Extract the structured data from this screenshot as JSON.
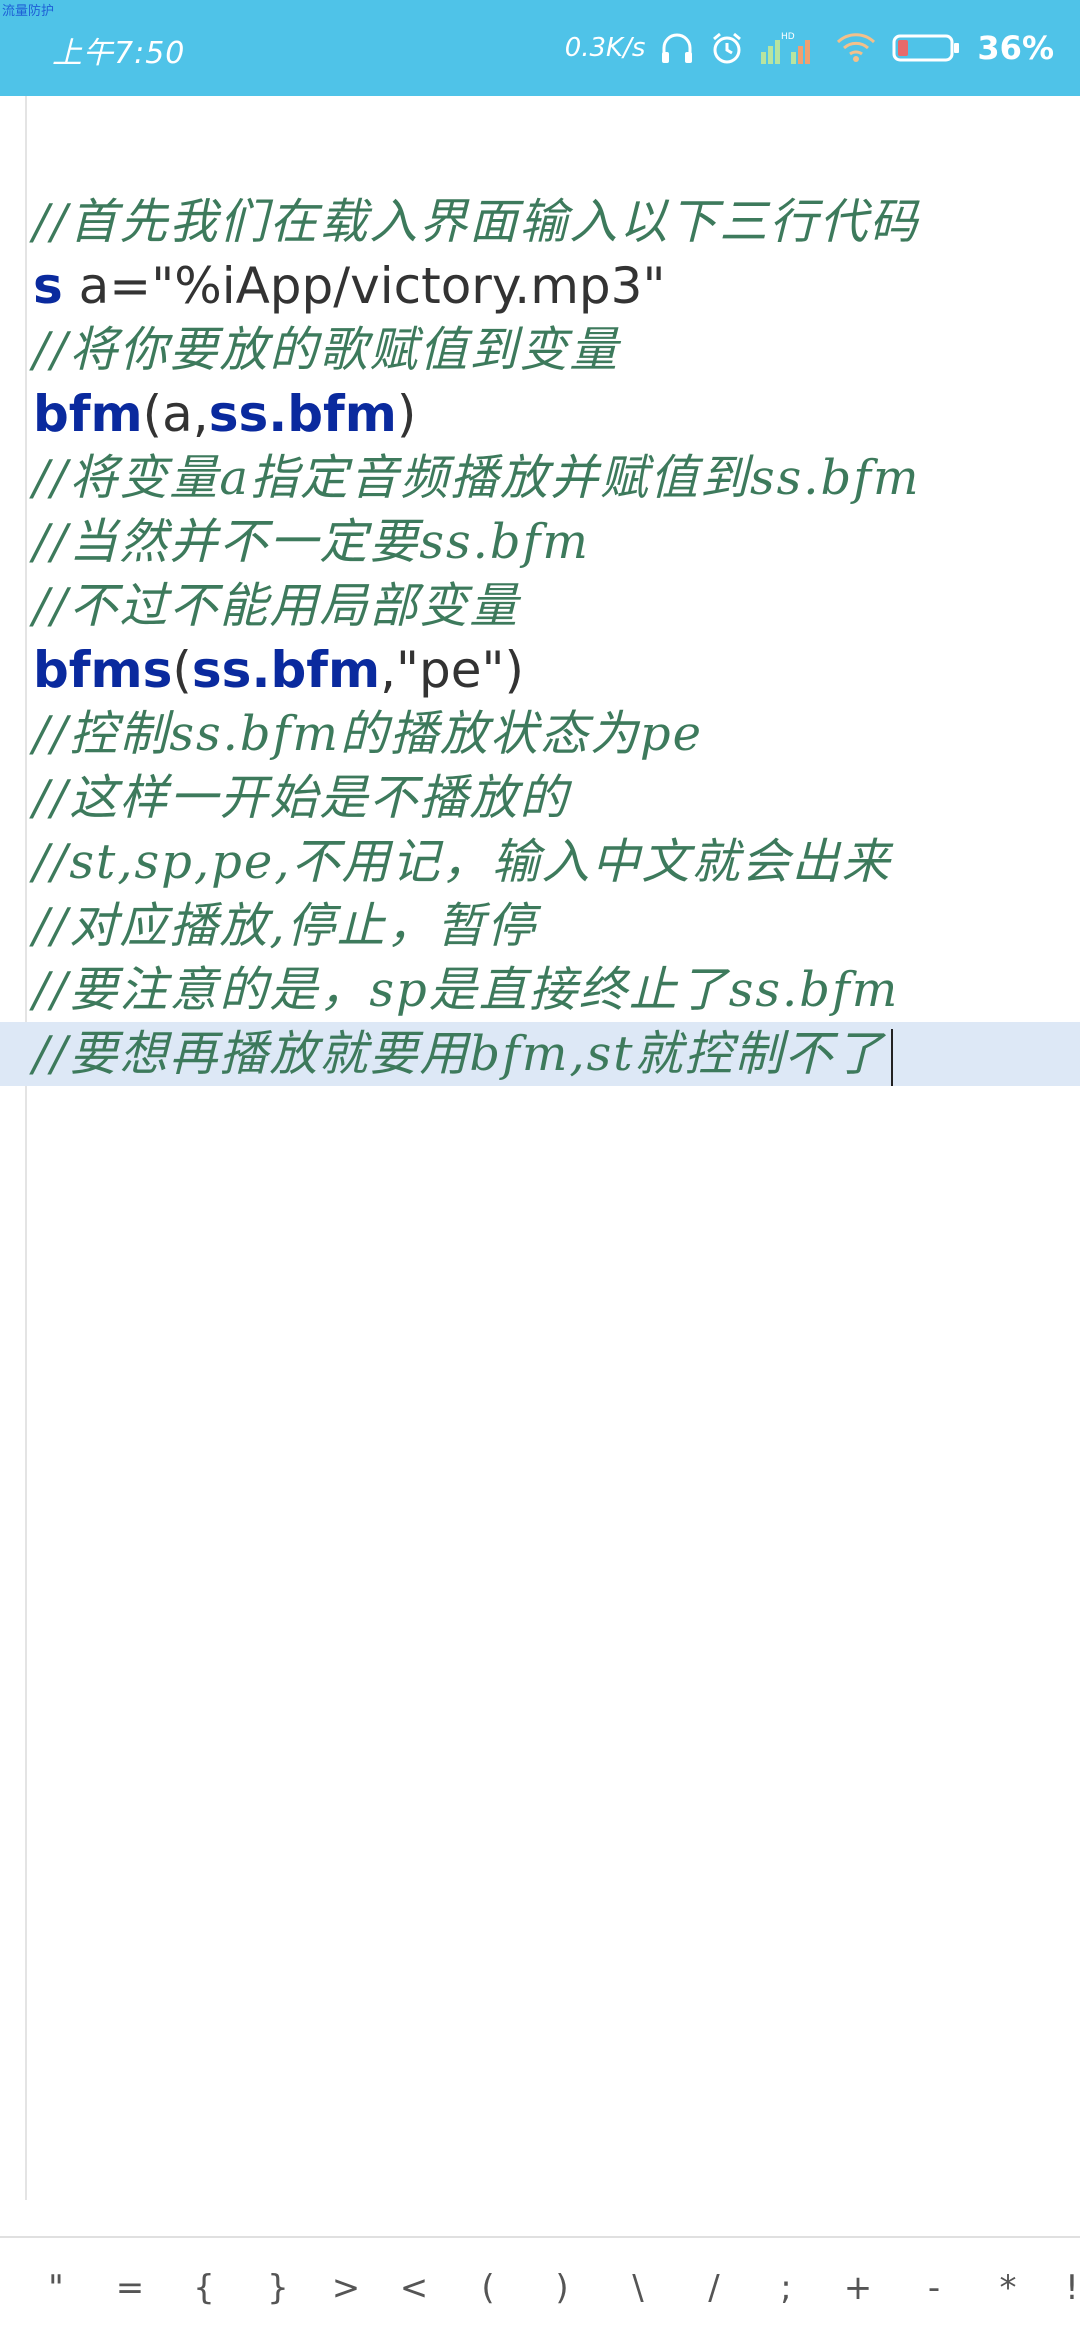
{
  "status_bar": {
    "tiny_label": "流量防护",
    "time": "上午7:50",
    "net_speed": "0.3K/s",
    "battery_percent": "36%",
    "battery_level": 0.2,
    "bg_color": "#4fc3e8"
  },
  "editor": {
    "lines": [
      {
        "kind": "comment",
        "text": "//首先我们在载入界面输入以下三行代码"
      },
      {
        "kind": "code",
        "parts": [
          "s",
          " a=\"%iApp/victory.mp3\""
        ]
      },
      {
        "kind": "comment",
        "text": "//将你要放的歌赋值到变量"
      },
      {
        "kind": "code",
        "parts": [
          "bfm",
          "(a,",
          "ss.bfm",
          ")"
        ]
      },
      {
        "kind": "comment",
        "text": "//将变量a指定音频播放并赋值到ss.bfm"
      },
      {
        "kind": "comment",
        "text": "//当然并不一定要ss.bfm"
      },
      {
        "kind": "comment",
        "text": "//不过不能用局部变量"
      },
      {
        "kind": "code",
        "parts": [
          "bfms",
          "(",
          "ss.bfm",
          ",\"pe\")"
        ]
      },
      {
        "kind": "comment",
        "text": "//控制ss.bfm的播放状态为pe"
      },
      {
        "kind": "comment",
        "text": "//这样一开始是不播放的"
      },
      {
        "kind": "comment",
        "text": "//st,sp,pe,不用记，输入中文就会出来"
      },
      {
        "kind": "comment",
        "text": "//对应播放,停止，暂停"
      },
      {
        "kind": "comment",
        "text": "//要注意的是，sp是直接终止了ss.bfm"
      },
      {
        "kind": "comment",
        "text": "//要想再播放就要用bfm,st就控制不了"
      }
    ],
    "keyword_color": "#0a2a9e",
    "comment_color": "#3d7a5c",
    "current_line_color": "#dde8f6"
  },
  "symbol_bar": {
    "symbols": [
      "\"",
      "=",
      "{",
      "}",
      ">",
      "<",
      "(",
      ")",
      "\\",
      "/",
      ";",
      "+",
      "-",
      "*",
      "!"
    ]
  }
}
